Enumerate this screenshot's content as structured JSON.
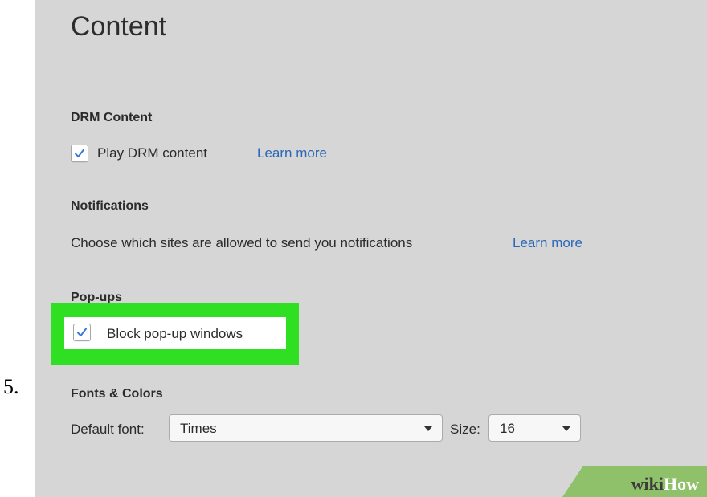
{
  "step": {
    "number": "5."
  },
  "page": {
    "title": "Content"
  },
  "drm": {
    "title": "DRM Content",
    "checkbox_label": "Play DRM content",
    "checked": true,
    "link": "Learn more"
  },
  "notifications": {
    "title": "Notifications",
    "description": "Choose which sites are allowed to send you notifications",
    "link": "Learn more"
  },
  "popups": {
    "title": "Pop-ups",
    "checkbox_label": "Block pop-up windows",
    "checked": true
  },
  "fonts": {
    "title": "Fonts & Colors",
    "default_font_label": "Default font:",
    "default_font_value": "Times",
    "size_label": "Size:",
    "size_value": "16"
  },
  "watermark": {
    "part1": "wiki",
    "part2": "How"
  },
  "colors": {
    "panel_bg": "#d6d6d6",
    "highlight": "#2ee021",
    "link": "#2a67b8",
    "checkmark": "#3a78d8"
  }
}
